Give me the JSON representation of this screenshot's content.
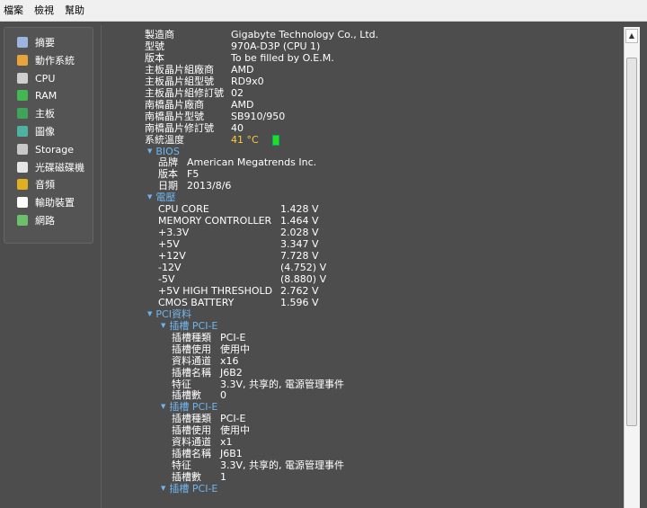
{
  "menu": [
    "檔案",
    "檢視",
    "幫助"
  ],
  "sidebar": [
    {
      "label": "摘要",
      "icon": "summary-icon",
      "color": "#9bb7e0"
    },
    {
      "label": "動作系統",
      "icon": "windows-icon",
      "color": "#e8a33a"
    },
    {
      "label": "CPU",
      "icon": "cpu-icon",
      "color": "#cfcfcf"
    },
    {
      "label": "RAM",
      "icon": "ram-icon",
      "color": "#42b852"
    },
    {
      "label": "主板",
      "icon": "motherboard-icon",
      "color": "#3fa35a"
    },
    {
      "label": "圖像",
      "icon": "graphics-icon",
      "color": "#4db3a0"
    },
    {
      "label": "Storage",
      "icon": "storage-icon",
      "color": "#c8c8c8"
    },
    {
      "label": "光碟磁碟機",
      "icon": "optical-drive-icon",
      "color": "#e6e6e6"
    },
    {
      "label": "音頻",
      "icon": "audio-icon",
      "color": "#e0b020"
    },
    {
      "label": "輸助裝置",
      "icon": "mouse-icon",
      "color": "#ffffff"
    },
    {
      "label": "網路",
      "icon": "network-icon",
      "color": "#6cc06c"
    }
  ],
  "board": [
    {
      "label": "製造商",
      "value": "Gigabyte Technology Co., Ltd."
    },
    {
      "label": "型號",
      "value": "970A-D3P (CPU 1)"
    },
    {
      "label": "版本",
      "value": "To be filled by O.E.M."
    },
    {
      "label": "主板晶片組廠商",
      "value": "AMD"
    },
    {
      "label": "主板晶片組型號",
      "value": "RD9x0"
    },
    {
      "label": "主板晶片組修訂號",
      "value": "02"
    },
    {
      "label": "南橋晶片廠商",
      "value": "AMD"
    },
    {
      "label": "南橋晶片型號",
      "value": "SB910/950"
    },
    {
      "label": "南橋晶片修訂號",
      "value": "40"
    },
    {
      "label": "系統溫度",
      "value": "41 °C"
    }
  ],
  "bios": {
    "title": "BIOS",
    "rows": [
      {
        "label": "品牌",
        "value": "American Megatrends Inc."
      },
      {
        "label": "版本",
        "value": "F5"
      },
      {
        "label": "日期",
        "value": "2013/8/6"
      }
    ]
  },
  "voltage": {
    "title": "電壓",
    "rows": [
      {
        "label": "CPU CORE",
        "value": "1.428 V"
      },
      {
        "label": "MEMORY CONTROLLER",
        "value": "1.464 V"
      },
      {
        "label": "+3.3V",
        "value": "2.028 V"
      },
      {
        "label": "+5V",
        "value": "3.347 V"
      },
      {
        "label": "+12V",
        "value": "7.728 V"
      },
      {
        "label": "-12V",
        "value": "(4.752) V"
      },
      {
        "label": "-5V",
        "value": "(8.880) V"
      },
      {
        "label": "+5V HIGH THRESHOLD",
        "value": "2.762 V"
      },
      {
        "label": "CMOS BATTERY",
        "value": "1.596 V"
      }
    ]
  },
  "pci": {
    "title": "PCI資料",
    "slots": [
      {
        "title": "插槽 PCI-E",
        "rows": [
          {
            "label": "插槽種類",
            "value": "PCI-E"
          },
          {
            "label": "插槽使用",
            "value": "使用中"
          },
          {
            "label": "資料通道",
            "value": "x16"
          },
          {
            "label": "插槽名稱",
            "value": "J6B2"
          },
          {
            "label": "特征",
            "value": "3.3V, 共享的, 電源管理事件"
          },
          {
            "label": "插槽數",
            "value": "0"
          }
        ]
      },
      {
        "title": "插槽 PCI-E",
        "rows": [
          {
            "label": "插槽種類",
            "value": "PCI-E"
          },
          {
            "label": "插槽使用",
            "value": "使用中"
          },
          {
            "label": "資料通道",
            "value": "x1"
          },
          {
            "label": "插槽名稱",
            "value": "J6B1"
          },
          {
            "label": "特征",
            "value": "3.3V, 共享的, 電源管理事件"
          },
          {
            "label": "插槽數",
            "value": "1"
          }
        ]
      },
      {
        "title": "插槽 PCI-E",
        "rows": []
      }
    ]
  }
}
